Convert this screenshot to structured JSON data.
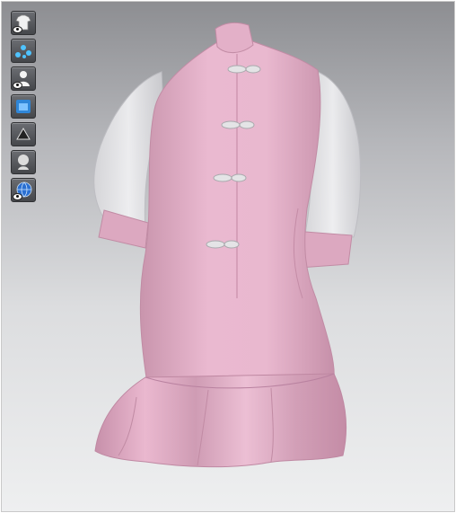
{
  "toolbar": {
    "tools": [
      {
        "icon": "garment-visibility-icon"
      },
      {
        "icon": "fabric-points-icon"
      },
      {
        "icon": "avatar-visibility-icon"
      },
      {
        "icon": "arrangement-icon"
      },
      {
        "icon": "texture-icon"
      },
      {
        "icon": "avatar-display-icon"
      },
      {
        "icon": "environment-globe-icon"
      }
    ]
  },
  "colors": {
    "fabric_pink": "#e8b8cf",
    "fabric_pink_shadow": "#c995ad",
    "sleeve_sheer": "#e9e9ec",
    "background_top": "#8d8e92",
    "background_bottom": "#eeeff0"
  }
}
